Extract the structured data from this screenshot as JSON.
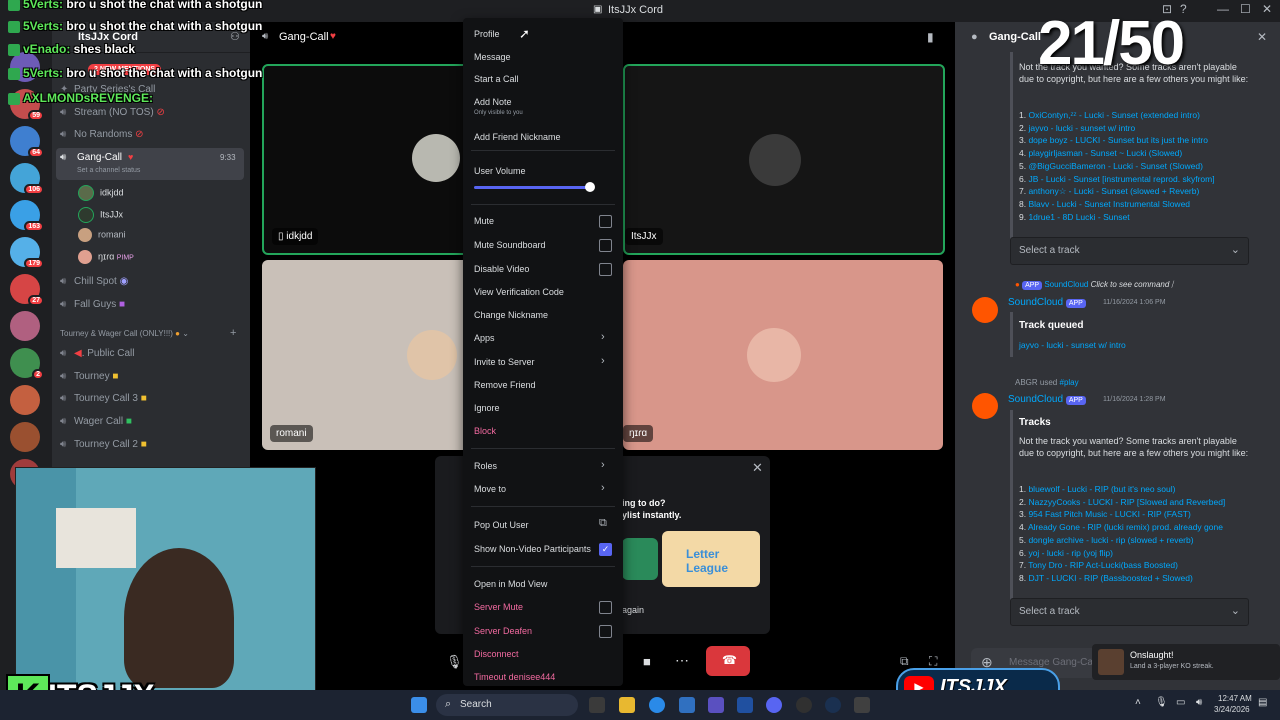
{
  "window": {
    "title": "ItsJJx Cord"
  },
  "server": {
    "name": "ItsJJx Cord",
    "mentions": "2 NEW MENTIONS"
  },
  "rail": [
    {
      "color": "#6d5bb7",
      "badge": ""
    },
    {
      "color": "#c44d4d",
      "badge": "59"
    },
    {
      "color": "#3f7fd0",
      "badge": "64"
    },
    {
      "color": "#44a4d8",
      "badge": "106"
    },
    {
      "color": "#3aa0e6",
      "badge": "163"
    },
    {
      "color": "#55b0e8",
      "badge": "179"
    },
    {
      "color": "#d64545",
      "badge": "27"
    },
    {
      "color": "#b06080",
      "badge": ""
    },
    {
      "color": "#3f8f4f",
      "badge": "2"
    },
    {
      "color": "#c46040",
      "badge": ""
    },
    {
      "color": "#9a5030",
      "badge": ""
    },
    {
      "color": "#a03c3c",
      "badge": ""
    }
  ],
  "channels": {
    "party": "Party Series's Call",
    "stream": "Stream (NO TOS)",
    "norandoms": "No Randoms",
    "gangcall": "Gang-Call",
    "gangcall_time": "9:33",
    "status": "Set a channel status",
    "users": [
      "idkjdd",
      "ItsJJx",
      "romani",
      "ŋɪɾɑ"
    ],
    "pimp": "PIMP",
    "chillspot": "Chill Spot",
    "fallguys": "Fall Guys",
    "category": "Tourney & Wager Call (ONLY!!!)",
    "publiccall": ". Public Call",
    "tourney": "Tourney",
    "tourney3": "Tourney Call 3",
    "wager": "Wager Call",
    "tourney2": "Tourney Call 2"
  },
  "stage": {
    "header": "Gang-Call",
    "tiles": [
      "idkjdd",
      "ItsJJx",
      "romani",
      "ŋɪɾɑ"
    ]
  },
  "popup": {
    "q": "ing to do?",
    "q2": "ylist instantly.",
    "again": "again",
    "league": "Letter League"
  },
  "context_menu": {
    "profile": "Profile",
    "message": "Message",
    "start_call": "Start a Call",
    "add_note": "Add Note",
    "only_visible": "Only visible to you",
    "add_friend_nickname": "Add Friend Nickname",
    "user_volume": "User Volume",
    "volume_pct": "100%",
    "mute": "Mute",
    "mute_soundboard": "Mute Soundboard",
    "disable_video": "Disable Video",
    "view_verification_code": "View Verification Code",
    "change_nickname": "Change Nickname",
    "apps": "Apps",
    "invite_to_server": "Invite to Server",
    "remove_friend": "Remove Friend",
    "ignore": "Ignore",
    "block": "Block",
    "roles": "Roles",
    "move_to": "Move to",
    "pop_out_user": "Pop Out User",
    "show_non_video": "Show Non-Video Participants",
    "open_mod_view": "Open in Mod View",
    "server_mute": "Server Mute",
    "server_deafen": "Server Deafen",
    "disconnect": "Disconnect",
    "timeout": "Timeout denisee444"
  },
  "rpanel": {
    "title": "Gang-Call",
    "note": "Not the track you wanted? Some tracks aren't playable due to copyright, but here are a few others you might like:",
    "tracks1": [
      "OxiContyn,ᶻᶻ - Lucki - Sunset (extended intro)",
      "jayvo - lucki - sunset w/ intro",
      "dope boyz - LUCKI - Sunset but its just the intro",
      "playgirljasman - Sunset ~ Lucki (Slowed)",
      "@BigGucciBameron - Lucki - Sunset (Slowed)",
      "JB - Lucki - Sunset [instrumental reprod. skyfrom]",
      "anthony☆ - Lucki - Sunset (slowed + Reverb)",
      "Blavv - Lucki - Sunset Instrumental Slowed",
      "1drue1 - 8D Lucki - Sunset"
    ],
    "select": "Select a track",
    "cmd_app": "APP",
    "cmd_sc": "SoundCloud",
    "cmd_click": "Click to see command",
    "bot": "SoundCloud",
    "bot_app": "APP",
    "time1": "11/16/2024 1:06 PM",
    "queued": "Track queued",
    "queued_track": "jayvo - lucki - sunset w/ intro",
    "used_user": "ABGR used",
    "used_cmd": "play",
    "time2": "11/16/2024 1:28 PM",
    "tracks_title": "Tracks",
    "tracks2": [
      "bluewolf - Lucki - RIP (but it's neo soul)",
      "NazzyyCooks - LUCKI - RIP [Slowed and Reverbed]",
      "954 Fast Pitch Music - LUCKI - RIP (FAST)",
      "Already Gone - RIP (lucki remix) prod. already gone",
      "dongle archive - lucki - rip (slowed + reverb)",
      "yoj - lucki - rip (yoj flip)",
      "Tony Dro - RIP Act-Lucki(bass Boosted)",
      "DJT - LUCKI - RIP (Bassboosted + Slowed)"
    ],
    "message_ph": "Message Gang-Ca"
  },
  "toast": {
    "title": "Onslaught!",
    "desc": "Land a 3-player KO streak."
  },
  "overlay": {
    "counter": "21/50",
    "chat": [
      {
        "name": "5Verts:",
        "msg": "bro u shot the chat with a shotgun"
      },
      {
        "name": "5Verts:",
        "msg": "bro u shot the chat with a shotgun"
      },
      {
        "name": "vEnado:",
        "msg": "shes black"
      },
      {
        "name": "5Verts:",
        "msg": "bro u shot the chat with a shotgun"
      },
      {
        "name": "AXLMONDsREVENGE:",
        "msg": ""
      }
    ],
    "brand": "ITSJJX",
    "brand2": "ITSJJX"
  },
  "taskbar": {
    "search": "Search",
    "time": "12:47 AM",
    "date": "3/24/2026"
  }
}
